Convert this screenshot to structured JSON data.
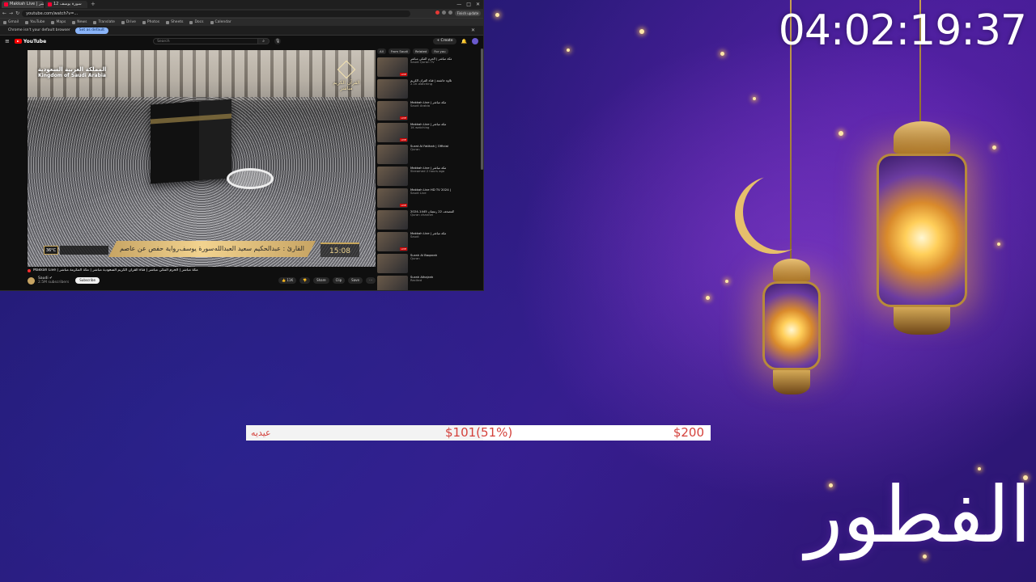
{
  "browser": {
    "tabs": [
      {
        "label": "Makkah Live | مكة مباشر",
        "active": true
      },
      {
        "label": "سورة يوسف 12",
        "active": false
      }
    ],
    "url": "youtube.com/watch?v=...",
    "profile_label": "Finish update",
    "bookmarks": [
      "Gmail",
      "YouTube",
      "Maps",
      "News",
      "Translate",
      "Drive",
      "Photos",
      "Sheets",
      "Docs",
      "Calendar"
    ],
    "infobar": {
      "message": "Chrome isn't your default browser",
      "button": "Set as default"
    }
  },
  "youtube": {
    "logo": "YouTube",
    "search_placeholder": "Search",
    "create_label": "+ Create",
    "video": {
      "overlay_ksa_ar": "المملكة العربية السعودية",
      "overlay_ksa_en": "Kingdom of Saudi Arabia",
      "overlay_channel_ar": "القرآن الكريم",
      "overlay_channel_sub": "مباشر",
      "temperature": "36°C",
      "surah": "سورة يوسف",
      "reciter": "القارئ : عبدالحكيم سعيد العبدالله",
      "narration": "رواية حفص عن عاصم",
      "time": "15:08"
    },
    "title": "Makkah Live | مكة مباشر | الحرم المكي مباشر | قناة القرآن الكريم السعودية مباشر | مكة المكرمة مباشر",
    "channel": {
      "name": "Saudi ✔",
      "subs": "2.5M subscribers",
      "subscribe_label": "Subscribe"
    },
    "actions": [
      "👍 11K",
      "👎",
      "Share",
      "Clip",
      "Save",
      "⋯"
    ],
    "chips": [
      "All",
      "From Saudi",
      "Related",
      "For you"
    ],
    "recommendations": [
      {
        "title": "مكة مباشر | الحرم المكي مباشر",
        "meta": "Saudi Quran TV",
        "live": true
      },
      {
        "title": "تلاوة خاشعة | قناة القرآن الكريم",
        "meta": "2.1K watching",
        "live": false
      },
      {
        "title": "Makkah Live | مكة مباشر",
        "meta": "Saudi Arabia",
        "live": true
      },
      {
        "title": "Makkah Live | مكة مباشر",
        "meta": "1K watching",
        "live": true
      },
      {
        "title": "Surat Al Fatihah | Official",
        "meta": "Quran",
        "live": false
      },
      {
        "title": "Makkah Live | مكة مباشر",
        "meta": "Streamed 2 hours ago",
        "live": false
      },
      {
        "title": "Makkah Live HD TV 2024 |",
        "meta": "Saudi Live",
        "live": true
      },
      {
        "title": "المصحف 22 رمضان 1445-2024",
        "meta": "Quran channel",
        "live": false
      },
      {
        "title": "Makkah Live | مكة مباشر",
        "meta": "Saudi",
        "live": true
      },
      {
        "title": "Surah Al Baqarah",
        "meta": "Quran",
        "live": false
      },
      {
        "title": "Surah Alhajrah",
        "meta": "Recited",
        "live": false
      }
    ]
  },
  "overlay": {
    "clock": "04:02:19:37",
    "goal": {
      "name": "عيديه",
      "raised": "$101(51%)",
      "target": "$200",
      "percent": 51
    },
    "eid_text": "الفطور"
  },
  "colors": {
    "progress_text": "#d4413b",
    "background": "#2a1a7a",
    "lantern_gold": "#e7c27a"
  }
}
